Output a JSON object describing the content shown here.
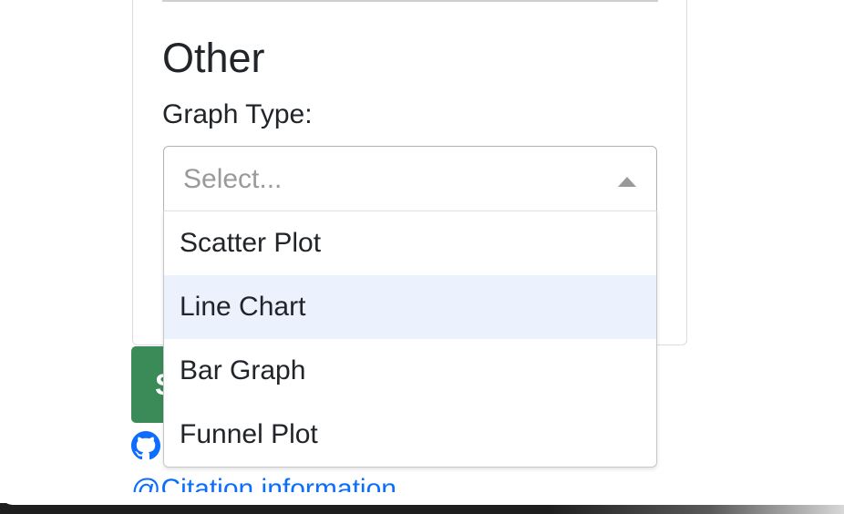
{
  "form": {
    "section_heading": "Other",
    "graph_type_label": "Graph Type:",
    "graph_type_select": {
      "placeholder": "Select...",
      "options": [
        "Scatter Plot",
        "Line Chart",
        "Bar Graph",
        "Funnel Plot"
      ],
      "focused_option": "Line Chart"
    }
  },
  "footer": {
    "submit_label": "S",
    "github_label": "G",
    "citation_prefix": "@",
    "citation_label": "Citation information"
  },
  "colors": {
    "submit_button": "#3a8b58",
    "link": "#0d6efd",
    "focused_option_bg": "#ebf2fe",
    "placeholder": "#9a9a9a"
  },
  "icons": {
    "select_arrow": "arrow-up-icon",
    "github": "github-icon"
  }
}
